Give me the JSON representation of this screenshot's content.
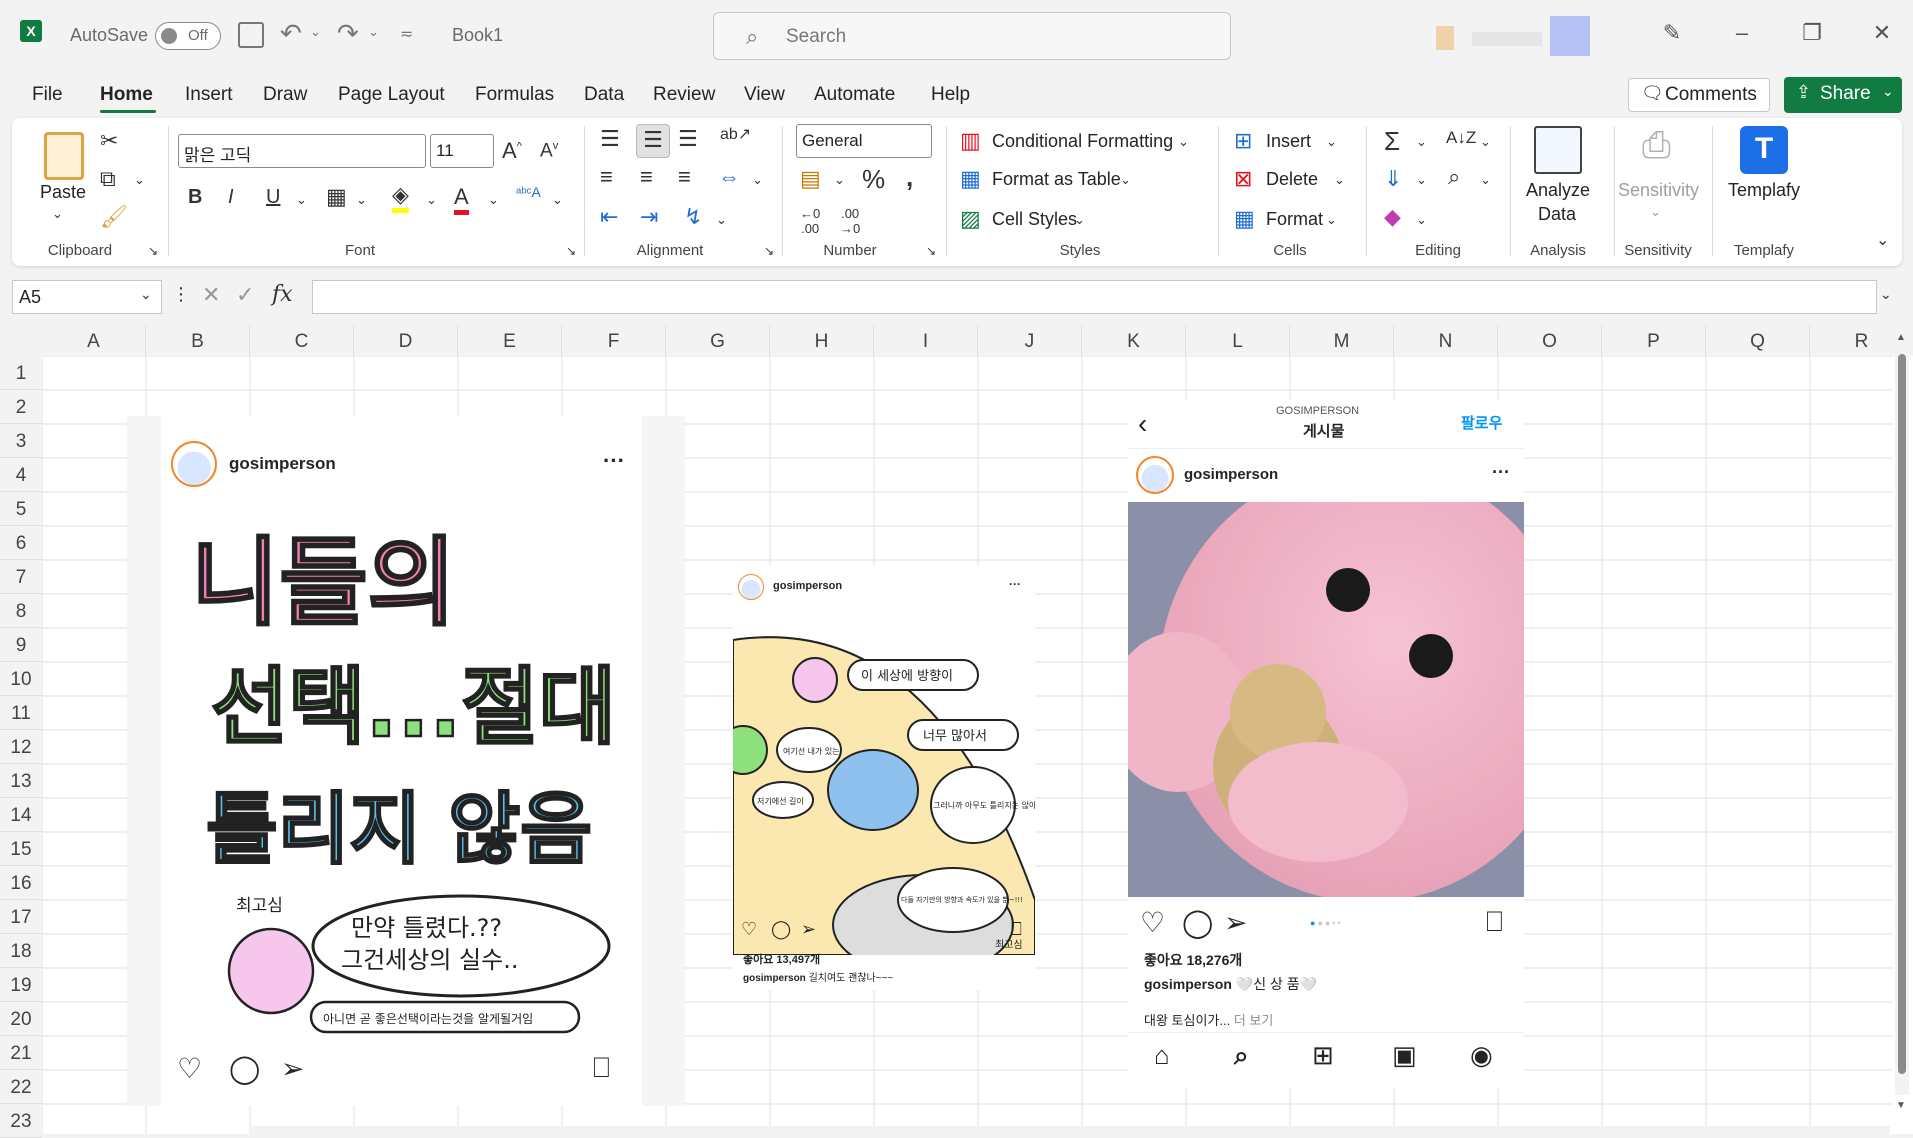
{
  "titlebar": {
    "autosave_label": "AutoSave",
    "autosave_state": "Off",
    "filename": "Book1",
    "search_placeholder": "Search"
  },
  "menu": {
    "items": [
      "File",
      "Home",
      "Insert",
      "Draw",
      "Page Layout",
      "Formulas",
      "Data",
      "Review",
      "View",
      "Automate",
      "Help"
    ],
    "active": "Home",
    "comments_label": "Comments",
    "share_label": "Share"
  },
  "ribbon": {
    "clipboard": {
      "paste": "Paste",
      "label": "Clipboard"
    },
    "font": {
      "family": "맑은 고딕",
      "size": "11",
      "label": "Font"
    },
    "alignment": {
      "label": "Alignment"
    },
    "number": {
      "format": "General",
      "label": "Number"
    },
    "styles": {
      "conditional": "Conditional Formatting",
      "format_table": "Format as Table",
      "cell_styles": "Cell Styles",
      "label": "Styles"
    },
    "cells": {
      "insert": "Insert",
      "delete": "Delete",
      "format": "Format",
      "label": "Cells"
    },
    "editing": {
      "label": "Editing"
    },
    "analysis": {
      "button_line1": "Analyze",
      "button_line2": "Data",
      "label": "Analysis"
    },
    "sensitivity": {
      "button": "Sensitivity",
      "label": "Sensitivity"
    },
    "templafy": {
      "button": "Templafy",
      "label": "Templafy"
    }
  },
  "formula_bar": {
    "name_box": "A5",
    "fx": "fx"
  },
  "columns": [
    "A",
    "B",
    "C",
    "D",
    "E",
    "F",
    "G",
    "H",
    "I",
    "J",
    "K",
    "L",
    "M",
    "N",
    "O",
    "P",
    "Q",
    "R"
  ],
  "rows": [
    "1",
    "2",
    "3",
    "4",
    "5",
    "6",
    "7",
    "8",
    "9",
    "10",
    "11",
    "12",
    "13",
    "14",
    "15",
    "16",
    "17",
    "18",
    "19",
    "20",
    "21",
    "22",
    "23"
  ],
  "post_left": {
    "username": "gosimperson",
    "art_line1": "니들의",
    "art_line2": "선택...절대",
    "art_line3": "틀리지 않음",
    "bubble_line1": "만약 틀렸다.??",
    "bubble_line2": "그건세상의 실수..",
    "signature": "최고심",
    "bottom_banner": "아니면 곧 좋은선택이라는것을 알게될거임"
  },
  "post_middle": {
    "username": "gosimperson",
    "bubble1": "이 세상에 방향이",
    "bubble2": "너무 많아서",
    "bubble3": "여기선 내가 있는",
    "bubble4": "저기에선 길이",
    "bubble5": "그러니까 아무도 틀리지는 않아",
    "bubble6": "다들 자기만의 방향과 속도가 있을 뿐~!!!",
    "signature": "최고심",
    "likes": "좋아요 13,497개",
    "caption_user": "gosimperson",
    "caption_text": "길치여도 괜찮나~~~"
  },
  "post_right": {
    "header_account": "GOSIMPERSON",
    "header_title": "게시물",
    "follow": "팔로우",
    "username": "gosimperson",
    "likes": "좋아요 18,276개",
    "caption_user": "gosimperson",
    "caption_text": "🤍신 상 품🤍",
    "caption_more_text": "대왕 토심이가...",
    "more_label": "더 보기"
  },
  "colors": {
    "excel_green": "#107c41",
    "ig_blue": "#0095f6",
    "pink_plush": "#f3b8c9"
  }
}
